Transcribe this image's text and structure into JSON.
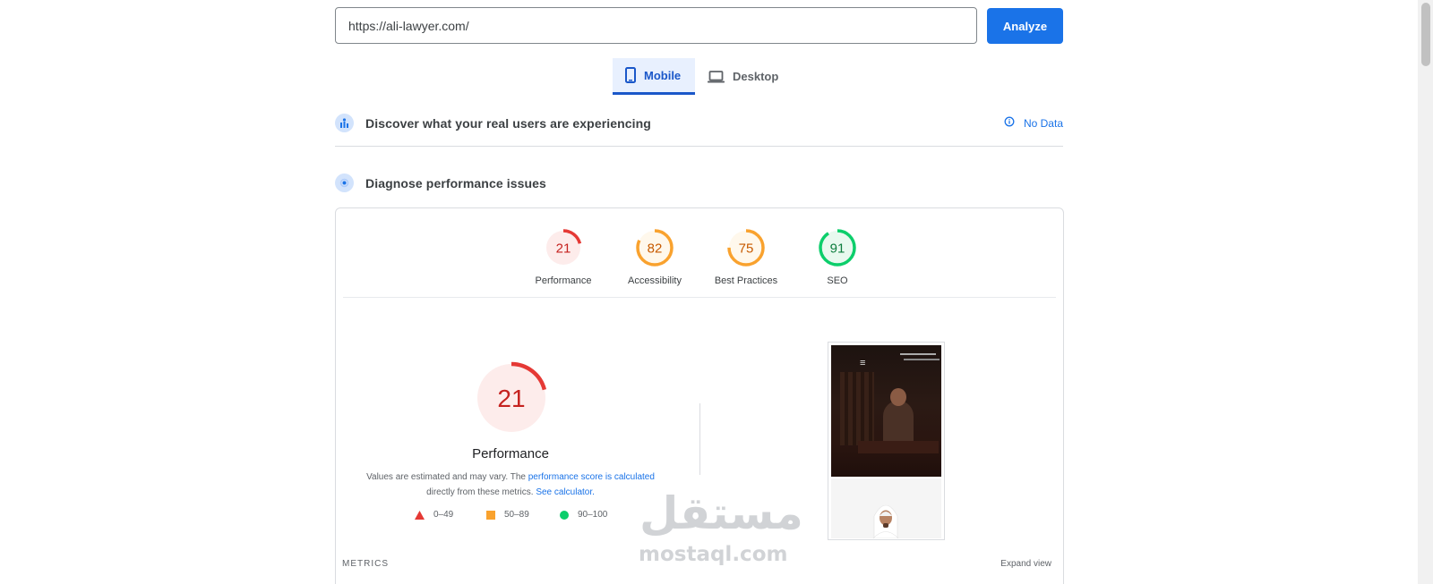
{
  "search": {
    "url_value": "https://ali-lawyer.com/",
    "analyze_label": "Analyze"
  },
  "tabs": [
    {
      "label": "Mobile",
      "active": true,
      "icon": "phone-icon"
    },
    {
      "label": "Desktop",
      "active": false,
      "icon": "laptop-icon"
    }
  ],
  "field_data": {
    "title": "Discover what your real users are experiencing",
    "status": "No Data",
    "icon": "users-chart-icon",
    "status_icon": "info-icon"
  },
  "lab_data": {
    "title": "Diagnose performance issues",
    "icon": "lighthouse-icon"
  },
  "categories": [
    {
      "label": "Performance",
      "score": "21",
      "value": 21,
      "color": "#e53935",
      "fill": "#fdeceb"
    },
    {
      "label": "Accessibility",
      "score": "82",
      "value": 82,
      "color": "#f9a22e",
      "fill": "#fff8ec"
    },
    {
      "label": "Best Practices",
      "score": "75",
      "value": 75,
      "color": "#f9a22e",
      "fill": "#fff8ec"
    },
    {
      "label": "SEO",
      "score": "91",
      "value": 91,
      "color": "#0cce6b",
      "fill": "#e8f9ef"
    }
  ],
  "performance": {
    "score": "21",
    "value": 21,
    "title": "Performance",
    "desc_prefix": "Values are estimated and may vary. The ",
    "desc_link1": "performance score is calculated",
    "desc_mid": "directly from these metrics. ",
    "desc_link2": "See calculator."
  },
  "legend": [
    {
      "range": "0–49",
      "shape": "triangle",
      "color": "#e53935"
    },
    {
      "range": "50–89",
      "shape": "square",
      "color": "#f9a22e"
    },
    {
      "range": "90–100",
      "shape": "circle",
      "color": "#0cce6b"
    }
  ],
  "metrics_label": "METRICS",
  "expand_label": "Expand view",
  "watermark": {
    "arabic": "مستقل",
    "latin": "mostaql.com"
  }
}
